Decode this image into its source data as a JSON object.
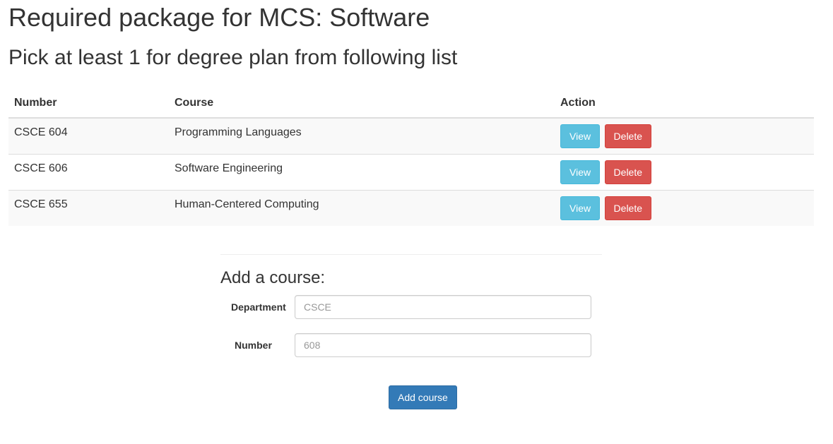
{
  "header": {
    "title": "Required package for MCS: Software",
    "subtitle": "Pick at least 1 for degree plan from following list"
  },
  "table": {
    "columns": [
      "Number",
      "Course",
      "Action"
    ],
    "rows": [
      {
        "number": "CSCE 604",
        "course": "Programming Languages"
      },
      {
        "number": "CSCE 606",
        "course": "Software Engineering"
      },
      {
        "number": "CSCE 655",
        "course": "Human-Centered Computing"
      }
    ],
    "view_label": "View",
    "delete_label": "Delete"
  },
  "add_form": {
    "heading": "Add a course:",
    "department_label": "Department",
    "department_placeholder": "CSCE",
    "department_value": "",
    "number_label": "Number",
    "number_placeholder": "608",
    "number_value": "",
    "submit_label": "Add course"
  },
  "colors": {
    "view_button": "#5bc0de",
    "delete_button": "#d9534f",
    "primary_button": "#337ab7",
    "stripe": "#f9f9f9"
  }
}
